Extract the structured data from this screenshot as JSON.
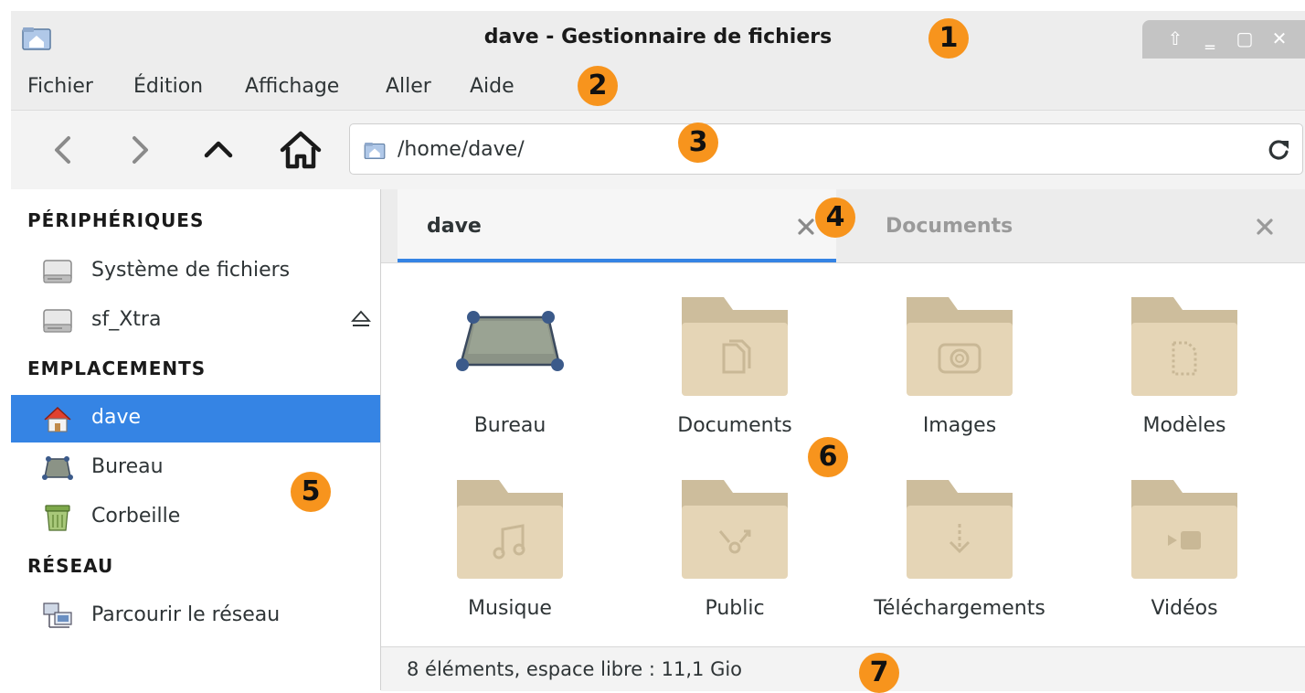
{
  "window": {
    "title": "dave - Gestionnaire de fichiers",
    "controls": {
      "up": "⇧",
      "minimize": "‗",
      "maximize": "▢",
      "close": "✕"
    }
  },
  "menu": [
    "Fichier",
    "Édition",
    "Affichage",
    "Aller",
    "Aide"
  ],
  "toolbar": {
    "back_icon": "chevron-left-icon",
    "forward_icon": "chevron-right-icon",
    "up_icon": "chevron-up-icon",
    "home_icon": "home-icon",
    "path": "/home/dave/",
    "reload_icon": "reload-icon"
  },
  "sidebar": {
    "sections": [
      {
        "header": "PÉRIPHÉRIQUES",
        "items": [
          {
            "label": "Système de fichiers",
            "icon": "drive-icon"
          },
          {
            "label": "sf_Xtra",
            "icon": "drive-icon",
            "eject": true
          }
        ]
      },
      {
        "header": "EMPLACEMENTS",
        "items": [
          {
            "label": "dave",
            "icon": "home-folder-icon",
            "selected": true
          },
          {
            "label": "Bureau",
            "icon": "desktop-icon"
          },
          {
            "label": "Corbeille",
            "icon": "trash-icon"
          }
        ]
      },
      {
        "header": "RÉSEAU",
        "items": [
          {
            "label": "Parcourir le réseau",
            "icon": "network-icon"
          }
        ]
      }
    ]
  },
  "tabs": [
    {
      "label": "dave",
      "active": true
    },
    {
      "label": "Documents",
      "active": false
    }
  ],
  "files": [
    {
      "label": "Bureau",
      "icon": "desktop-icon"
    },
    {
      "label": "Documents",
      "icon": "folder-documents-icon"
    },
    {
      "label": "Images",
      "icon": "folder-pictures-icon"
    },
    {
      "label": "Modèles",
      "icon": "folder-templates-icon"
    },
    {
      "label": "Musique",
      "icon": "folder-music-icon"
    },
    {
      "label": "Public",
      "icon": "folder-public-icon"
    },
    {
      "label": "Téléchargements",
      "icon": "folder-download-icon"
    },
    {
      "label": "Vidéos",
      "icon": "folder-videos-icon"
    }
  ],
  "status": "8 éléments, espace libre : 11,1 Gio",
  "callouts": [
    "1",
    "2",
    "3",
    "4",
    "5",
    "6",
    "7"
  ],
  "colors": {
    "accent": "#3584e4",
    "callout": "#f7941d",
    "folder": "#e5d5b6",
    "folder_tab": "#cdbd9c"
  }
}
